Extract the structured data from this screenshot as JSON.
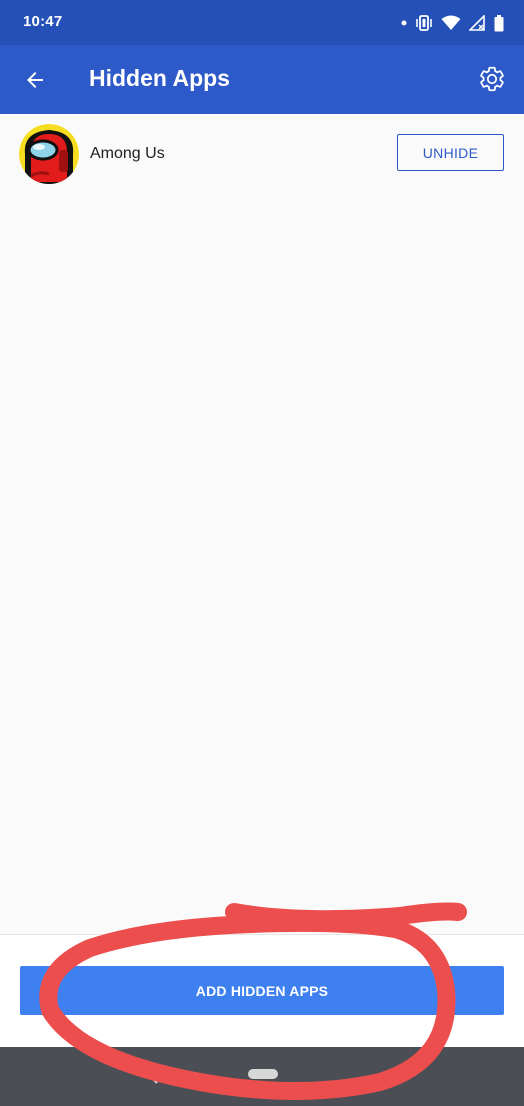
{
  "status_bar": {
    "time": "10:47",
    "icons": [
      "notification-dot-icon",
      "vibrate-icon",
      "wifi-icon",
      "signal-icon",
      "battery-icon"
    ]
  },
  "app_bar": {
    "title": "Hidden Apps",
    "back_icon": "arrow-back-icon",
    "settings_icon": "gear-icon"
  },
  "hidden_apps": [
    {
      "name": "Among Us",
      "action_label": "UNHIDE"
    }
  ],
  "footer": {
    "add_label": "ADD HIDDEN APPS"
  },
  "nav_bar": {
    "icons": [
      "nav-back-icon",
      "nav-home-pill"
    ]
  },
  "colors": {
    "status_bar": "#2450b8",
    "app_bar": "#2d5ac8",
    "background": "#fafafa",
    "accent_button": "#3f80f0",
    "nav_bar": "#4b4f55",
    "annotation": "#ec4e4e"
  }
}
